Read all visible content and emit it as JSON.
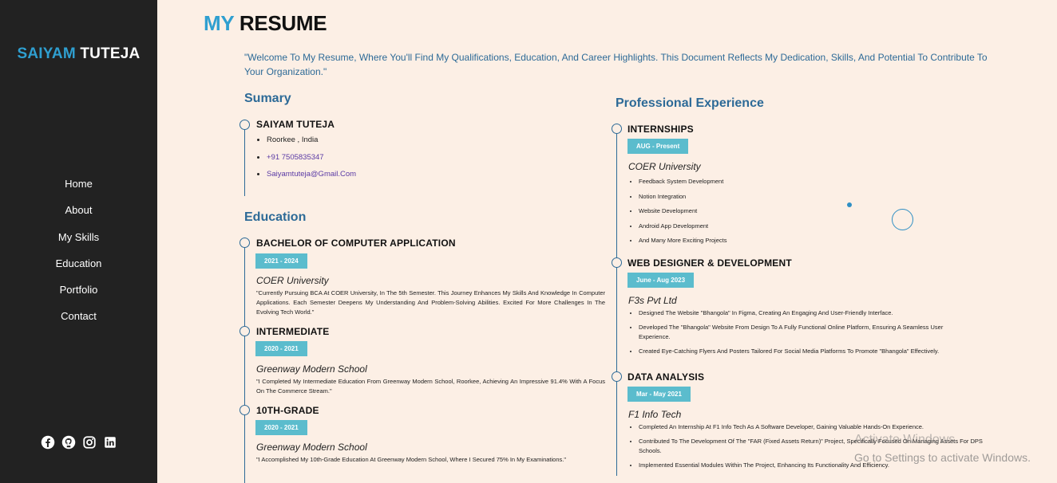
{
  "sidebar": {
    "brand_first": "SAIYAM",
    "brand_last": "TUTEJA",
    "nav": [
      "Home",
      "About",
      "My Skills",
      "Education",
      "Portfolio",
      "Contact"
    ],
    "social_icons": [
      "facebook-icon",
      "github-icon",
      "instagram-icon",
      "linkedin-icon"
    ]
  },
  "header": {
    "title_accent": "MY",
    "title_rest": "RESUME",
    "intro": "\"Welcome To My Resume, Where You'll Find My Qualifications, Education, And Career Highlights. This Document Reflects My Dedication, Skills, And Potential To Contribute To Your Organization.\""
  },
  "summary": {
    "heading": "Sumary",
    "name": "SAIYAM TUTEJA",
    "location": "Roorkee , India",
    "phone": "+91 7505835347",
    "email": "Saiyamtuteja@Gmail.Com"
  },
  "education": {
    "heading": "Education",
    "items": [
      {
        "title": "BACHELOR OF COMPUTER APPLICATION",
        "dates": "2021 - 2024",
        "org": "COER University",
        "desc": "\"Currently Pursuing BCA At COER University, In The 5th Semester. This Journey Enhances My Skills And Knowledge In Computer Applications. Each Semester Deepens My Understanding And Problem-Solving Abilities. Excited For More Challenges In The Evolving Tech World.\""
      },
      {
        "title": "INTERMEDIATE",
        "dates": "2020 - 2021",
        "org": "Greenway Modern School",
        "desc": "\"I Completed My Intermediate Education From Greenway Modern School, Roorkee, Achieving An Impressive 91.4% With A Focus On The Commerce Stream.\""
      },
      {
        "title": "10TH-GRADE",
        "dates": "2020 - 2021",
        "org": "Greenway Modern School",
        "desc": "\"I Accomplished My 10th-Grade Education At Greenway Modern School, Where I Secured 75% In My Examinations.\""
      }
    ]
  },
  "experience": {
    "heading": "Professional Experience",
    "items": [
      {
        "title": "INTERNSHIPS",
        "dates": "AUG - Present",
        "org": "COER University",
        "bullets": [
          "Feedback System Development",
          "Notion Integration",
          "Website Development",
          "Android App Development",
          "And Many More Exciting Projects"
        ]
      },
      {
        "title": "WEB DESIGNER & DEVELOPMENT",
        "dates": "June - Aug 2023",
        "org": "F3s Pvt Ltd",
        "bullets": [
          "Designed The Website \"Bhangola\" In Figma, Creating An Engaging And User-Friendly Interface.",
          "Developed The \"Bhangola\" Website From Design To A Fully Functional Online Platform, Ensuring A Seamless User Experience.",
          "Created Eye-Catching Flyers And Posters Tailored For Social Media Platforms To Promote \"Bhangola\" Effectively."
        ]
      },
      {
        "title": "DATA ANALYSIS",
        "dates": "Mar - May 2021",
        "org": "F1 Info Tech",
        "bullets": [
          "Completed An Internship At F1 Info Tech As A Software Developer, Gaining Valuable Hands-On Experience.",
          "Contributed To The Development Of The \"FAR (Fixed Assets Return)\" Project, Specifically Focused On Managing Assets For DPS Schools.",
          "Implemented Essential Modules Within The Project, Enhancing Its Functionality And Efficiency."
        ]
      }
    ]
  },
  "watermark": {
    "line1": "Activate Windows",
    "line2": "Go to Settings to activate Windows."
  }
}
